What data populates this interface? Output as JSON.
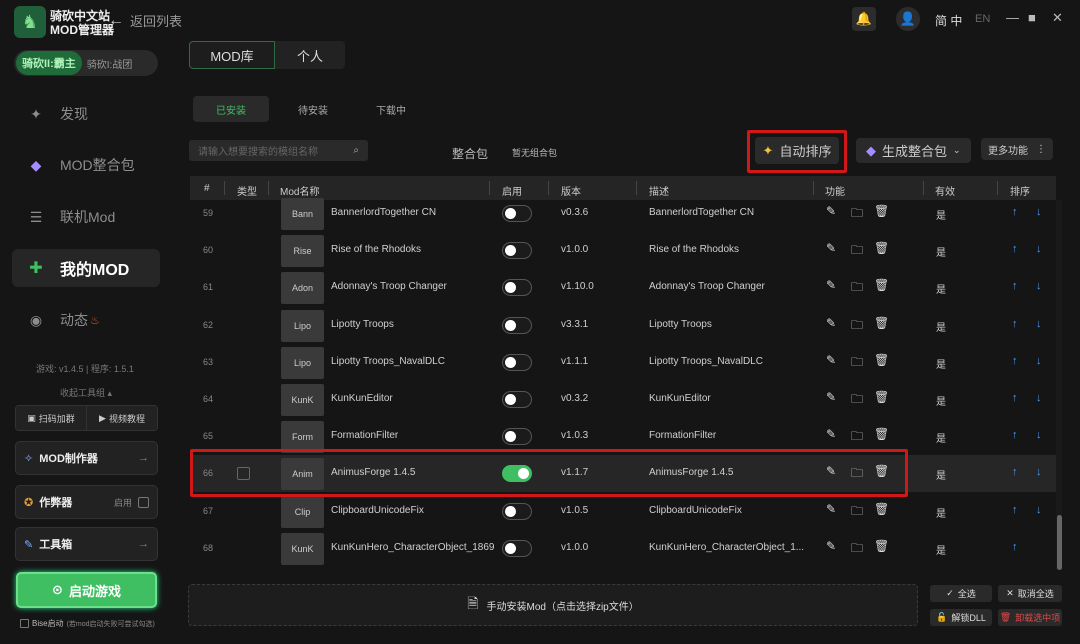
{
  "app": {
    "logo_line1": "骑砍中文站",
    "logo_line2": "MOD管理器",
    "back_label": "返回列表",
    "lang_cn": "简 中",
    "lang_en": "EN"
  },
  "sidebar": {
    "game_active": "骑砍II:霸主",
    "game_other": "骑砍I:战团",
    "nav": [
      {
        "label": "发现"
      },
      {
        "label": "MOD整合包"
      },
      {
        "label": "联机Mod"
      },
      {
        "label": "我的MOD"
      },
      {
        "label": "动态"
      }
    ],
    "version": "游戏: v1.4.5 | 程序: 1.5.1",
    "collapse": "收起工具组 ▴",
    "scan_label": "扫码加群",
    "video_label": "视频教程",
    "mod_maker": "MOD制作器",
    "cheat": "作弊器",
    "cheat_state": "启用",
    "toolbox": "工具箱",
    "start_game": "启动游戏",
    "bise_label": "Bise启动",
    "bise_note": "(若mod启动失败可尝试勾选)"
  },
  "main": {
    "tabs": [
      "MOD库",
      "个人"
    ],
    "subtabs": [
      "已安装",
      "待安装",
      "下载中"
    ],
    "search_placeholder": "请输入想要搜索的模组名称",
    "pack_label": "整合包",
    "pack_value": "暂无组合包",
    "auto_sort": "自动排序",
    "gen_pack": "生成整合包",
    "more": "更多功能",
    "columns": {
      "num": "#",
      "type": "类型",
      "name": "Mod名称",
      "enable": "启用",
      "version": "版本",
      "desc": "描述",
      "func": "功能",
      "valid": "有效",
      "sort": "排序"
    },
    "rows": [
      {
        "n": "59",
        "thumb": "Bann",
        "name": "BannerlordTogether CN",
        "on": false,
        "ver": "v0.3.6",
        "desc": "BannerlordTogether CN",
        "valid": "是",
        "up": true,
        "down": true
      },
      {
        "n": "60",
        "thumb": "Rise",
        "name": "Rise of the Rhodoks",
        "on": false,
        "ver": "v1.0.0",
        "desc": "Rise of the Rhodoks",
        "valid": "是",
        "up": true,
        "down": true
      },
      {
        "n": "61",
        "thumb": "Adon",
        "name": "Adonnay's Troop Changer",
        "on": false,
        "ver": "v1.10.0",
        "desc": "Adonnay's Troop Changer",
        "valid": "是",
        "up": true,
        "down": true
      },
      {
        "n": "62",
        "thumb": "Lipo",
        "name": "Lipotty Troops",
        "on": false,
        "ver": "v3.3.1",
        "desc": "Lipotty Troops",
        "valid": "是",
        "up": true,
        "down": true
      },
      {
        "n": "63",
        "thumb": "Lipo",
        "name": "Lipotty Troops_NavalDLC",
        "on": false,
        "ver": "v1.1.1",
        "desc": "Lipotty Troops_NavalDLC",
        "valid": "是",
        "up": true,
        "down": true
      },
      {
        "n": "64",
        "thumb": "KunK",
        "name": "KunKunEditor",
        "on": false,
        "ver": "v0.3.2",
        "desc": "KunKunEditor",
        "valid": "是",
        "up": true,
        "down": true
      },
      {
        "n": "65",
        "thumb": "Form",
        "name": "FormationFilter",
        "on": false,
        "ver": "v1.0.3",
        "desc": "FormationFilter",
        "valid": "是",
        "up": true,
        "down": true
      },
      {
        "n": "66",
        "thumb": "Anim",
        "name": "AnimusForge 1.4.5",
        "on": true,
        "ver": "v1.1.7",
        "desc": "AnimusForge 1.4.5",
        "valid": "是",
        "up": true,
        "down": true
      },
      {
        "n": "67",
        "thumb": "Clip",
        "name": "ClipboardUnicodeFix",
        "on": false,
        "ver": "v1.0.5",
        "desc": "ClipboardUnicodeFix",
        "valid": "是",
        "up": true,
        "down": true
      },
      {
        "n": "68",
        "thumb": "KunK",
        "name": "KunKunHero_CharacterObject_1869",
        "on": false,
        "ver": "v1.0.0",
        "desc": "KunKunHero_CharacterObject_1...",
        "valid": "是",
        "up": true,
        "down": false
      }
    ],
    "install_label": "手动安装Mod（点击选择zip文件）",
    "select_all": "全选",
    "deselect_all": "取消全选",
    "unlock_dll": "解锁DLL",
    "uninstall_selected": "卸载选中项"
  },
  "colors": {
    "accent": "#3fbf62",
    "highlight": "#d01818",
    "arrow": "#4a9df5"
  }
}
